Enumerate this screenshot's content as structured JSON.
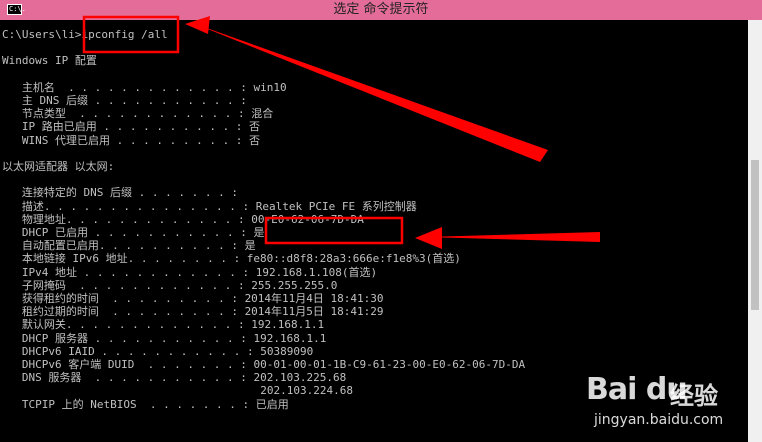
{
  "window": {
    "icon_label": "C:\\.",
    "title": "选定 命令提示符"
  },
  "terminal": {
    "lines": [
      "C:\\Users\\li>ipconfig /all",
      "",
      "Windows IP 配置",
      "",
      "   主机名  . . . . . . . . . . . . . : win10",
      "   主 DNS 后缀 . . . . . . . . . . . :",
      "   节点类型  . . . . . . . . . . . . : 混合",
      "   IP 路由已启用 . . . . . . . . . . : 否",
      "   WINS 代理已启用 . . . . . . . . . : 否",
      "",
      "以太网适配器 以太网:",
      "",
      "   连接特定的 DNS 后缀 . . . . . . . :",
      "   描述. . . . . . . . . . . . . . . : Realtek PCIe FE 系列控制器",
      "   物理地址. . . . . . . . . . . . . : 00-E0-62-06-7D-DA",
      "   DHCP 已启用 . . . . . . . . . . . : 是",
      "   自动配置已启用. . . . . . . . . . : 是",
      "   本地链接 IPv6 地址. . . . . . . . : fe80::d8f8:28a3:666e:f1e8%3(首选)",
      "   IPv4 地址 . . . . . . . . . . . . : 192.168.1.108(首选)",
      "   子网掩码  . . . . . . . . . . . . : 255.255.255.0",
      "   获得租约的时间  . . . . . . . . . : 2014年11月4日 18:41:30",
      "   租约过期的时间  . . . . . . . . . : 2014年11月5日 18:41:29",
      "   默认网关. . . . . . . . . . . . . : 192.168.1.1",
      "   DHCP 服务器 . . . . . . . . . . . : 192.168.1.1",
      "   DHCPv6 IAID . . . . . . . . . . . : 50389090",
      "   DHCPv6 客户端 DUID  . . . . . . . : 00-01-00-01-1B-C9-61-23-00-E0-62-06-7D-DA",
      "   DNS 服务器  . . . . . . . . . . . : 202.103.225.68",
      "                                       202.103.224.68",
      "   TCPIP 上的 NetBIOS  . . . . . . . : 已启用"
    ]
  },
  "annotation": {
    "color": "#ff0000"
  },
  "watermark": {
    "logo": "Bai du",
    "name": "经验",
    "url": "jingyan.baidu.com"
  }
}
